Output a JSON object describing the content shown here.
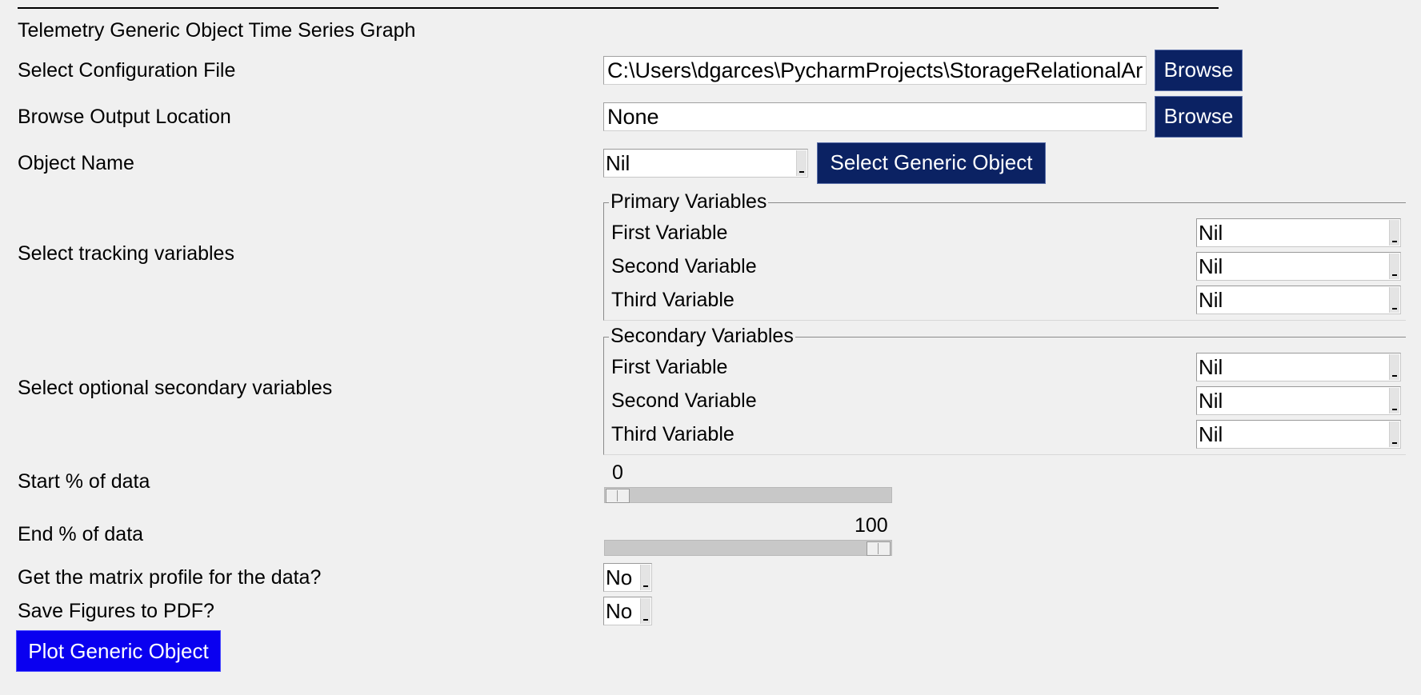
{
  "window": {
    "title": "Telemetry Generic Object Time Series Graph"
  },
  "config": {
    "label": "Select Configuration File",
    "value": "C:\\Users\\dgarces\\PycharmProjects\\StorageRelationalAr",
    "browse_label": "Browse"
  },
  "output": {
    "label": "Browse Output Location",
    "value": "None",
    "browse_label": "Browse"
  },
  "object": {
    "label": "Object Name",
    "selected": "Nil",
    "select_button": "Select Generic Object"
  },
  "primary": {
    "row_label": "Select tracking variables",
    "group_title": "Primary Variables",
    "vars": [
      {
        "label": "First Variable",
        "value": "Nil"
      },
      {
        "label": "Second Variable",
        "value": "Nil"
      },
      {
        "label": "Third Variable",
        "value": "Nil"
      }
    ]
  },
  "secondary": {
    "row_label": "Select optional secondary variables",
    "group_title": "Secondary Variables",
    "vars": [
      {
        "label": "First Variable",
        "value": "Nil"
      },
      {
        "label": "Second Variable",
        "value": "Nil"
      },
      {
        "label": "Third Variable",
        "value": "Nil"
      }
    ]
  },
  "start_slider": {
    "label": "Start % of data",
    "value": "0",
    "fraction": 0
  },
  "end_slider": {
    "label": "End % of data",
    "value": "100",
    "fraction": 1
  },
  "matrix_profile": {
    "label": "Get the matrix profile for the data?",
    "selected": "No"
  },
  "save_pdf": {
    "label": "Save Figures to PDF?",
    "selected": "No"
  },
  "plot_button": "Plot Generic Object",
  "colors": {
    "button_bg": "#0b2263",
    "plot_button_bg": "#0a00f0",
    "background": "#f0f0f0"
  }
}
